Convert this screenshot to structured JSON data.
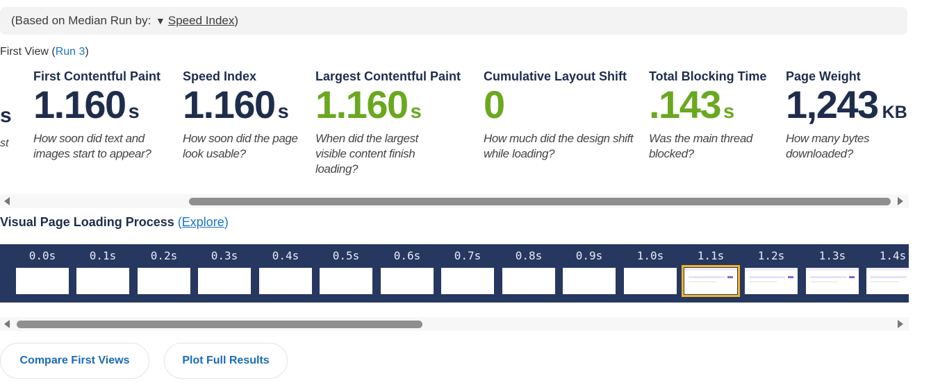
{
  "median": {
    "prefix": "(Based on Median Run by:",
    "arrow": "▼",
    "metric_link": "Speed Index",
    "suffix": ")"
  },
  "first_view": {
    "label": "First View (",
    "run_link": "Run 3",
    "close": ")"
  },
  "partial_prev": {
    "unit": "s",
    "desc_fragment": "st"
  },
  "metrics": [
    {
      "label": "First Contentful Paint",
      "value": "1.160",
      "unit": "s",
      "desc": "How soon did text and images start to appear?",
      "color": "#1f2d4d"
    },
    {
      "label": "Speed Index",
      "value": "1.160",
      "unit": "s",
      "desc": "How soon did the page look usable?",
      "color": "#1f2d4d"
    },
    {
      "label": "Largest Contentful Paint",
      "value": "1.160",
      "unit": "s",
      "desc": "When did the largest visible content finish loading?",
      "color": "#6aa820"
    },
    {
      "label": "Cumulative Layout Shift",
      "value": "0",
      "unit": "",
      "desc": "How much did the design shift while loading?",
      "color": "#6aa820"
    },
    {
      "label": "Total Blocking Time",
      "value": ".143",
      "unit": "s",
      "desc": "Was the main thread blocked?",
      "color": "#6aa820"
    },
    {
      "label": "Page Weight",
      "value": "1,243",
      "unit": "KB",
      "desc": "How many bytes downloaded?",
      "color": "#1f2d4d"
    }
  ],
  "visual": {
    "title": "Visual Page Loading Process",
    "open": "(",
    "explore_link": "Explore",
    "close": ")"
  },
  "filmstrip": {
    "frames": [
      "0.0s",
      "0.1s",
      "0.2s",
      "0.3s",
      "0.4s",
      "0.5s",
      "0.6s",
      "0.7s",
      "0.8s",
      "0.9s",
      "1.0s",
      "1.1s",
      "1.2s",
      "1.3s",
      "1.4s"
    ],
    "selected": "1.1s",
    "selected_color": "#f4b424"
  },
  "buttons": {
    "compare": "Compare First Views",
    "plot": "Plot Full Results"
  }
}
